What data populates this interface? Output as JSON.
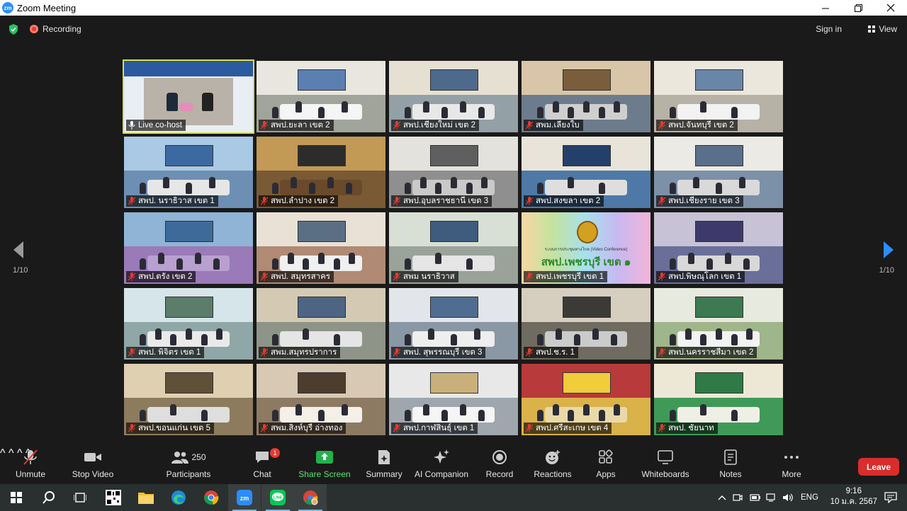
{
  "window": {
    "app_icon": "zm",
    "title": "Zoom Meeting",
    "controls": [
      "minimize-icon",
      "maximize-icon",
      "close-icon"
    ]
  },
  "topbar": {
    "recording_label": "Recording",
    "signin_label": "Sign in",
    "view_label": "View"
  },
  "gallery": {
    "page_left": "1/10",
    "page_right": "1/10",
    "tiles": [
      {
        "label": "Live co-host",
        "active": true
      },
      {
        "label": "สพป.ยะลา เขต 2"
      },
      {
        "label": "สพป.เชียงใหม่ เขต 2"
      },
      {
        "label": "สพม.เลียงใบ"
      },
      {
        "label": "สพป.จันทบุรี เขต 2"
      },
      {
        "label": "สพป. นราธิวาส เขต 1"
      },
      {
        "label": "สพป.ลำปาง เขต 2"
      },
      {
        "label": "สพป.อุบลราชธานี เขต 3"
      },
      {
        "label": "สพป.สงขลา เขต 2"
      },
      {
        "label": "สพป.เชียงราย เขต 3"
      },
      {
        "label": "สพป.ตรัง เขต 2"
      },
      {
        "label": "สพป. สมุทรสาคร"
      },
      {
        "label": "สพม นราธิวาส"
      },
      {
        "label": "สพป.เพชรบุรี เขต 1"
      },
      {
        "label": "สพป.พิษณุโลก เขต 1"
      },
      {
        "label": "สพป. พิจิตร เขต 1"
      },
      {
        "label": "สพม.สมุทรปราการ"
      },
      {
        "label": "สพป. สุพรรณบุรี เขต 3"
      },
      {
        "label": "สพป.ช.ร. 1"
      },
      {
        "label": "สพป.นครราชสีมา เขต 2"
      },
      {
        "label": "สพป.ขอนแก่น เขต 5"
      },
      {
        "label": "สพม.สิงห์บุรี อ่างทอง"
      },
      {
        "label": "สพป.กาฬสินธุ์ เขต 1"
      },
      {
        "label": "สพป.ศรีสะเกษ เขต 4"
      },
      {
        "label": "สพป. ชัยนาท"
      }
    ],
    "sign_text": "สพป.เพชรบุรี เขต ๑",
    "sign_subtext": "ระบบการประชุมทางไกล (Video Conference)"
  },
  "toolbar": {
    "unmute": "Unmute",
    "stop_video": "Stop Video",
    "participants": "Participants",
    "participants_count": "250",
    "chat": "Chat",
    "chat_badge": "1",
    "share_screen": "Share Screen",
    "summary": "Summary",
    "ai_companion": "AI Companion",
    "record": "Record",
    "reactions": "Reactions",
    "apps": "Apps",
    "whiteboards": "Whiteboards",
    "notes": "Notes",
    "more": "More",
    "leave": "Leave"
  },
  "taskbar": {
    "apps": [
      "windows-start-icon",
      "search-icon",
      "task-view-icon",
      "qr-app-icon",
      "file-explorer-icon",
      "edge-icon",
      "chrome-icon",
      "zoom-icon",
      "line-icon",
      "chrome-profile-icon"
    ],
    "lang": "ENG",
    "time": "9:16",
    "date": "10 ม.ค. 2567"
  },
  "colors": {
    "accent_share": "#5be46e",
    "leave": "#d92d2b",
    "active_speaker": "#d7e04a",
    "zoom_blue": "#2d8cff"
  }
}
